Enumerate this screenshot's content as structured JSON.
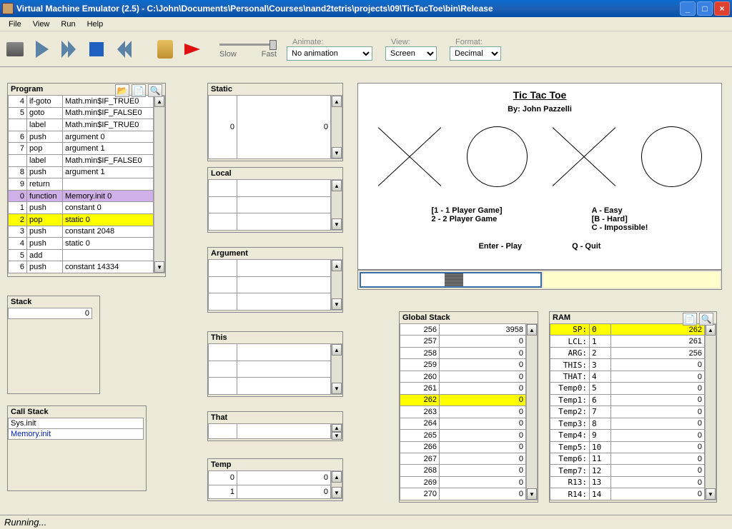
{
  "window": {
    "title": "Virtual Machine Emulator (2.5) - C:\\John\\Documents\\Personal\\Courses\\nand2tetris\\projects\\09\\TicTacToe\\bin\\Release"
  },
  "menu": {
    "items": [
      "File",
      "View",
      "Run",
      "Help"
    ]
  },
  "toolbar": {
    "slow": "Slow",
    "fast": "Fast",
    "animate": "Animate:",
    "animate_val": "No animation",
    "view": "View:",
    "view_val": "Screen",
    "format": "Format:",
    "format_val": "Decimal"
  },
  "program": {
    "title": "Program",
    "rows": [
      {
        "n": "4",
        "op": "if-goto",
        "arg": "Math.min$IF_TRUE0"
      },
      {
        "n": "5",
        "op": "goto",
        "arg": "Math.min$IF_FALSE0"
      },
      {
        "n": "",
        "op": "label",
        "arg": "Math.min$IF_TRUE0"
      },
      {
        "n": "6",
        "op": "push",
        "arg": "argument 0"
      },
      {
        "n": "7",
        "op": "pop",
        "arg": "argument 1"
      },
      {
        "n": "",
        "op": "label",
        "arg": "Math.min$IF_FALSE0"
      },
      {
        "n": "8",
        "op": "push",
        "arg": "argument 1"
      },
      {
        "n": "9",
        "op": "return",
        "arg": ""
      },
      {
        "n": "0",
        "op": "function",
        "arg": "Memory.init 0",
        "hl": "purple"
      },
      {
        "n": "1",
        "op": "push",
        "arg": "constant 0"
      },
      {
        "n": "2",
        "op": "pop",
        "arg": "static 0",
        "hl": "yellow"
      },
      {
        "n": "3",
        "op": "push",
        "arg": "constant 2048"
      },
      {
        "n": "4",
        "op": "push",
        "arg": "static 0"
      },
      {
        "n": "5",
        "op": "add",
        "arg": ""
      },
      {
        "n": "6",
        "op": "push",
        "arg": "constant 14334"
      }
    ]
  },
  "stack": {
    "title": "Stack",
    "val": "0"
  },
  "callstack": {
    "title": "Call Stack",
    "items": [
      "Sys.init",
      "Memory.init"
    ]
  },
  "segments": {
    "static": {
      "title": "Static",
      "rows": [
        {
          "i": "0",
          "v": "0"
        }
      ]
    },
    "local": {
      "title": "Local",
      "rows": [
        {
          "i": "",
          "v": ""
        },
        {
          "i": "",
          "v": ""
        },
        {
          "i": "",
          "v": ""
        }
      ]
    },
    "argument": {
      "title": "Argument",
      "rows": [
        {
          "i": "",
          "v": ""
        },
        {
          "i": "",
          "v": ""
        },
        {
          "i": "",
          "v": ""
        }
      ]
    },
    "this": {
      "title": "This",
      "rows": [
        {
          "i": "",
          "v": ""
        },
        {
          "i": "",
          "v": ""
        },
        {
          "i": "",
          "v": ""
        }
      ]
    },
    "that": {
      "title": "That",
      "rows": [
        {
          "i": "",
          "v": ""
        }
      ]
    },
    "temp": {
      "title": "Temp",
      "rows": [
        {
          "i": "0",
          "v": "0"
        },
        {
          "i": "1",
          "v": "0"
        }
      ]
    }
  },
  "screen": {
    "title": "Tic Tac Toe",
    "by": "By: John Pazzelli",
    "opt1": "[1 - 1 Player Game]",
    "opt2": " 2 - 2 Player Game ",
    "diffA": " A - Easy",
    "diffB": "[B - Hard]",
    "diffC": " C - Impossible!",
    "enter": "Enter - Play",
    "quit": "Q - Quit"
  },
  "globalstack": {
    "title": "Global Stack",
    "rows": [
      {
        "a": "256",
        "v": "3958"
      },
      {
        "a": "257",
        "v": "0"
      },
      {
        "a": "258",
        "v": "0"
      },
      {
        "a": "259",
        "v": "0"
      },
      {
        "a": "260",
        "v": "0"
      },
      {
        "a": "261",
        "v": "0"
      },
      {
        "a": "262",
        "v": "0",
        "hl": "yellow"
      },
      {
        "a": "263",
        "v": "0"
      },
      {
        "a": "264",
        "v": "0"
      },
      {
        "a": "265",
        "v": "0"
      },
      {
        "a": "266",
        "v": "0"
      },
      {
        "a": "267",
        "v": "0"
      },
      {
        "a": "268",
        "v": "0"
      },
      {
        "a": "269",
        "v": "0"
      },
      {
        "a": "270",
        "v": "0"
      }
    ]
  },
  "ram": {
    "title": "RAM",
    "rows": [
      {
        "l": "SP:",
        "i": "0",
        "v": "262",
        "hl": "yellow"
      },
      {
        "l": "LCL:",
        "i": "1",
        "v": "261"
      },
      {
        "l": "ARG:",
        "i": "2",
        "v": "256"
      },
      {
        "l": "THIS:",
        "i": "3",
        "v": "0"
      },
      {
        "l": "THAT:",
        "i": "4",
        "v": "0"
      },
      {
        "l": "Temp0:",
        "i": "5",
        "v": "0"
      },
      {
        "l": "Temp1:",
        "i": "6",
        "v": "0"
      },
      {
        "l": "Temp2:",
        "i": "7",
        "v": "0"
      },
      {
        "l": "Temp3:",
        "i": "8",
        "v": "0"
      },
      {
        "l": "Temp4:",
        "i": "9",
        "v": "0"
      },
      {
        "l": "Temp5:",
        "i": "10",
        "v": "0"
      },
      {
        "l": "Temp6:",
        "i": "11",
        "v": "0"
      },
      {
        "l": "Temp7:",
        "i": "12",
        "v": "0"
      },
      {
        "l": "R13:",
        "i": "13",
        "v": "0"
      },
      {
        "l": "R14:",
        "i": "14",
        "v": "0"
      }
    ]
  },
  "status": "Running..."
}
